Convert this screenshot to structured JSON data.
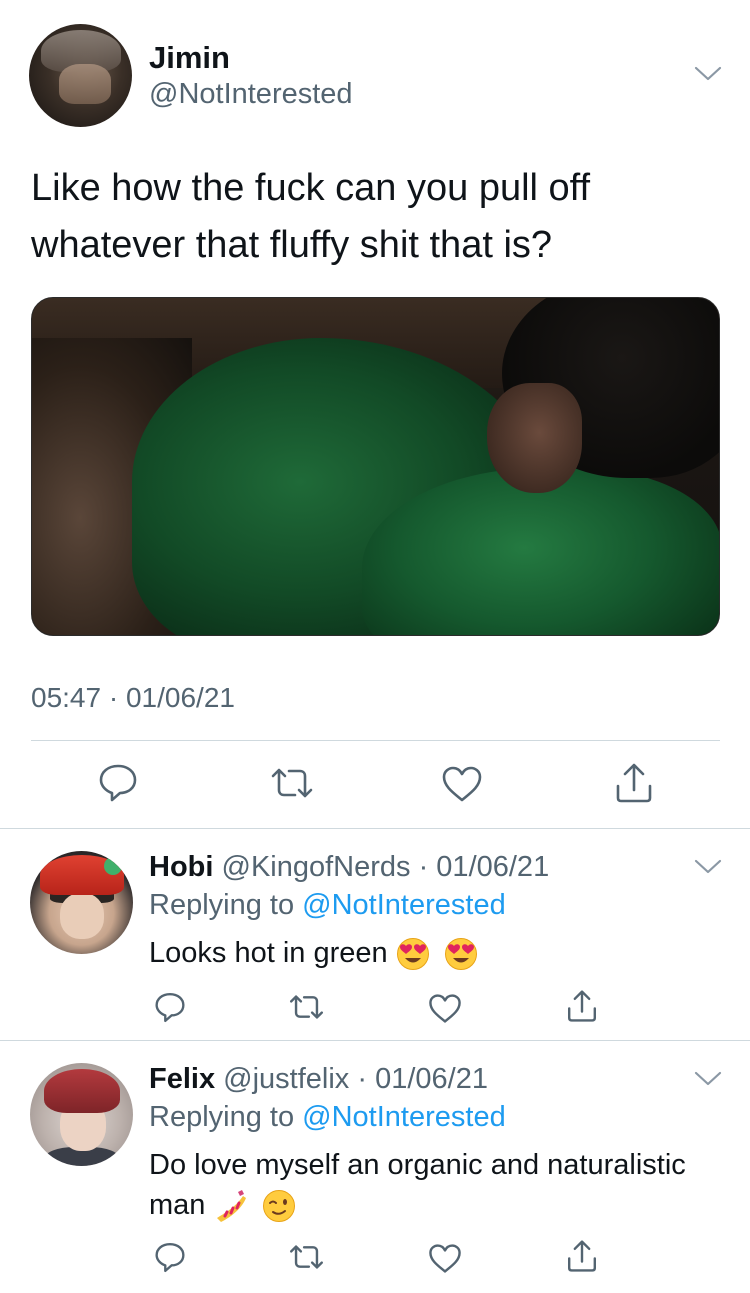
{
  "main_tweet": {
    "author_name": "Jimin",
    "author_handle": "@NotInterested",
    "text": "Like how the fuck can you pull off whatever that fluffy shit that is?",
    "time": "05:47",
    "separator": "·",
    "date": "01/06/21",
    "actions": [
      "reply-icon",
      "retweet-icon",
      "like-icon",
      "share-icon"
    ]
  },
  "replies": [
    {
      "name": "Hobi",
      "handle": "@KingofNerds",
      "date": "· 01/06/21",
      "replying_label": "Replying to",
      "replying_to": "@NotInterested",
      "text": "Looks hot in green",
      "emojis": [
        "heart-eyes-emoji",
        "heart-eyes-emoji"
      ]
    },
    {
      "name": "Felix",
      "handle": "@justfelix",
      "date": "· 01/06/21",
      "replying_label": "Replying to",
      "replying_to": "@NotInterested",
      "text": "Do love myself an organic and naturalistic man",
      "emojis": [
        "nail-polish-emoji",
        "winking-face-emoji"
      ]
    }
  ],
  "colors": {
    "text": "#0f1419",
    "secondary": "#536471",
    "link": "#1d9bf0",
    "divider": "#cfd9de"
  }
}
